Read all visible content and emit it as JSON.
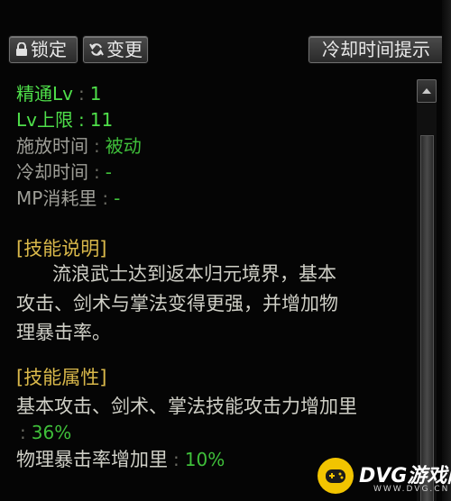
{
  "toolbar": {
    "lock_label": "锁定",
    "change_label": "变更",
    "cooldown_hint_label": "冷却时间提示"
  },
  "stats": {
    "mastery": {
      "label": "精通Lv",
      "value": "1"
    },
    "lv_cap": {
      "label": "Lv上限",
      "value": "11"
    },
    "cast_time": {
      "label": "施放时间",
      "value": "被动"
    },
    "cooldown": {
      "label": "冷却时间",
      "value": "-"
    },
    "mp_cost": {
      "label": "MP消耗里",
      "value": "-"
    },
    "separator": ":"
  },
  "description": {
    "header": "[技能说明]",
    "lines": [
      "流浪武士达到返本归元境界，基本",
      "攻击、剑术与掌法变得更强，并增加物",
      "理暴击率。"
    ]
  },
  "attributes": {
    "header": "[技能属性]",
    "line1": "基本攻击、剑术、掌法技能攻击力增加里",
    "line1_value": "36%",
    "line2": "物理暴击率增加里",
    "line2_value": "10%"
  },
  "watermark": {
    "brand": "DVG游戏网",
    "url": "WWW.DVG.CN"
  },
  "colors": {
    "label_green": "#4fe04a",
    "value_green": "#3fbf3a",
    "header_gold": "#d9b84a",
    "watermark_yellow": "#f2c400"
  }
}
